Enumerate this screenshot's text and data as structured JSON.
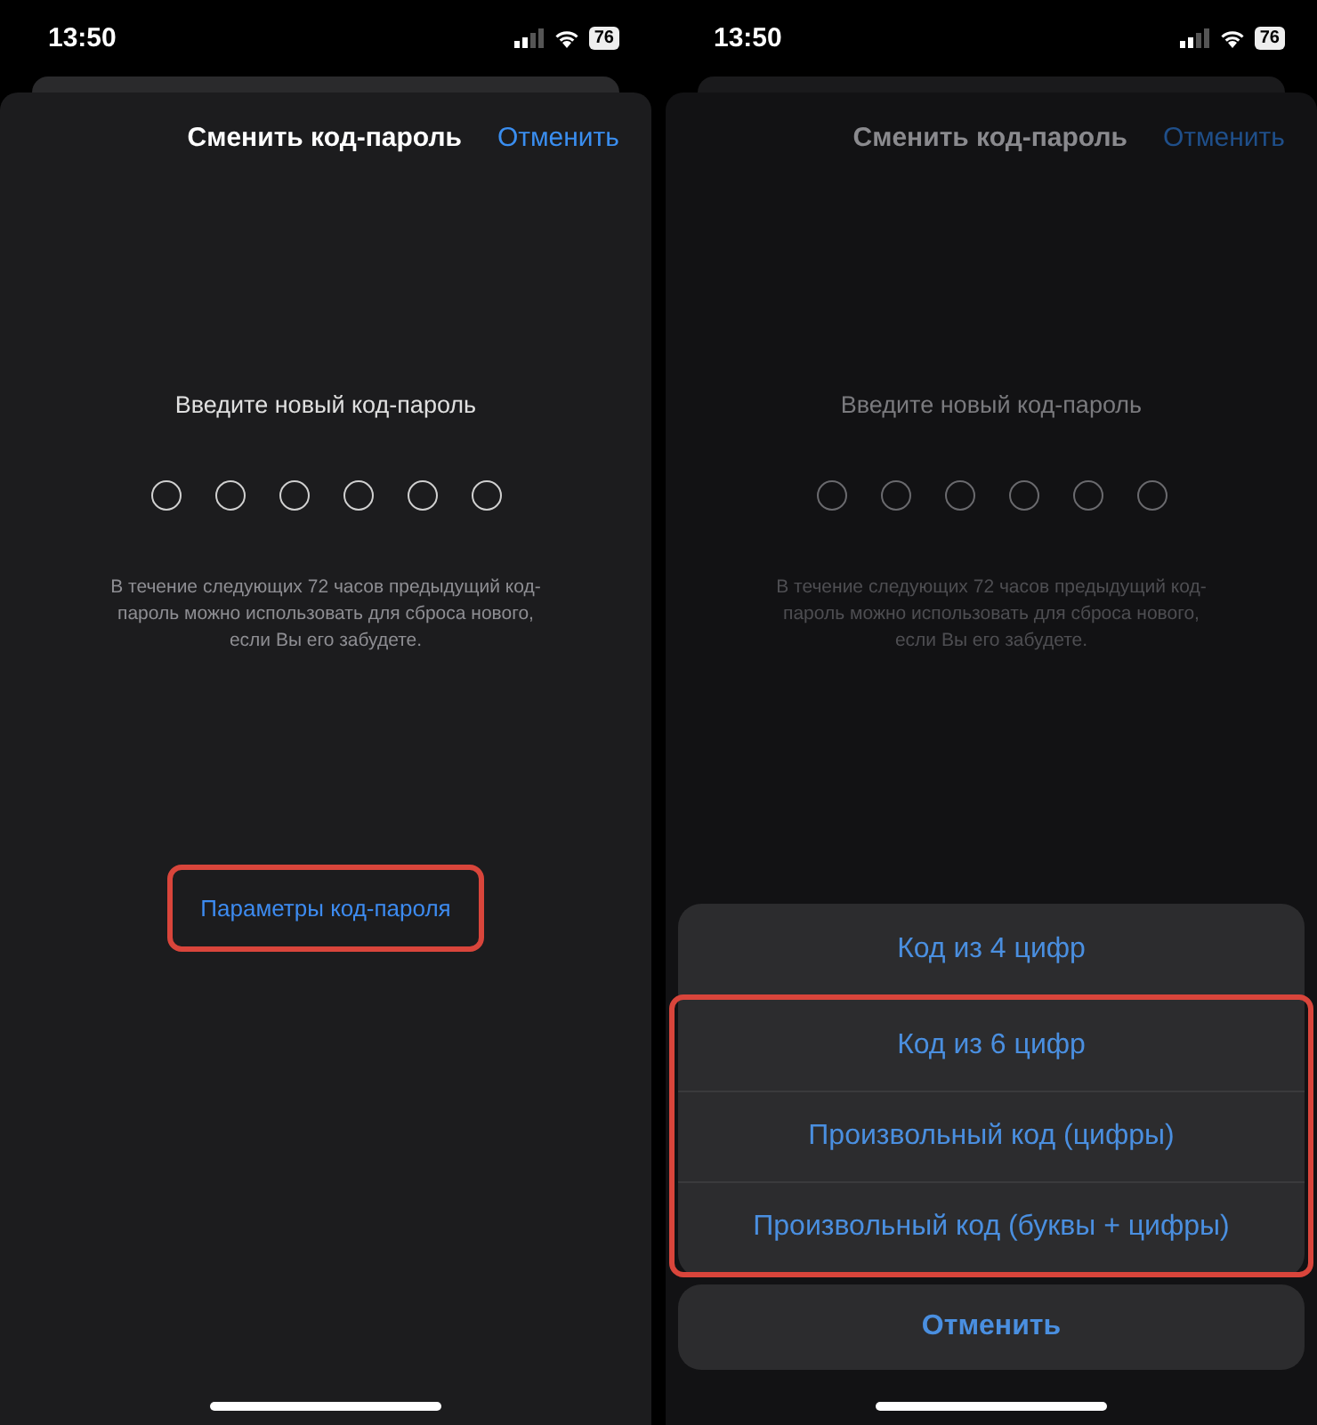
{
  "screens": [
    {
      "dimmed": false,
      "status_bar": {
        "time": "13:50",
        "battery": "76"
      },
      "nav": {
        "title": "Сменить код-пароль",
        "cancel": "Отменить"
      },
      "prompt": "Введите новый код-пароль",
      "dots": [
        {
          "filled": false
        },
        {
          "filled": false
        },
        {
          "filled": false
        },
        {
          "filled": false
        },
        {
          "filled": false
        },
        {
          "filled": false
        }
      ],
      "hint": "В течение следующих 72 часов предыдущий код-пароль можно использовать для сброса нового, если Вы его забудете.",
      "options_link": {
        "label": "Параметры код-пароля",
        "highlighted": true
      }
    },
    {
      "dimmed": true,
      "status_bar": {
        "time": "13:50",
        "battery": "76"
      },
      "nav": {
        "title": "Сменить код-пароль",
        "cancel": "Отменить"
      },
      "prompt": "Введите новый код-пароль",
      "dots": [
        {
          "filled": false
        },
        {
          "filled": false
        },
        {
          "filled": false
        },
        {
          "filled": false
        },
        {
          "filled": false
        },
        {
          "filled": false
        }
      ],
      "hint": "В течение следующих 72 часов предыдущий код-пароль можно использовать для сброса нового, если Вы его забудете.",
      "action_sheet": {
        "options": [
          {
            "label": "Код из 4 цифр",
            "highlighted": false
          },
          {
            "label": "Код из 6 цифр",
            "highlighted": true
          },
          {
            "label": "Произвольный код (цифры)",
            "highlighted": true
          },
          {
            "label": "Произвольный код (буквы + цифры)",
            "highlighted": true
          }
        ],
        "cancel": "Отменить"
      }
    }
  ]
}
